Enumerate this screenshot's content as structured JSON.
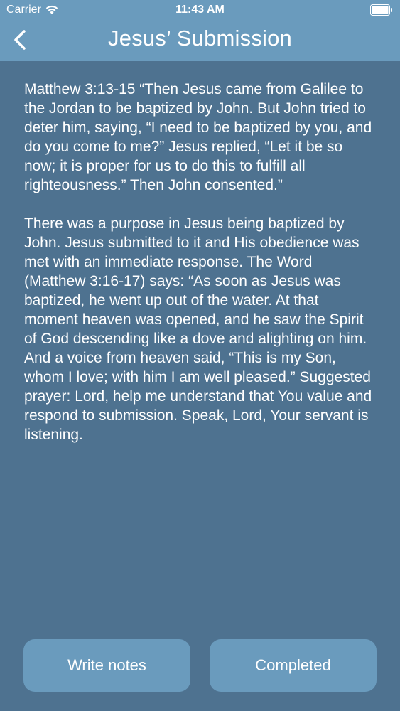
{
  "status_bar": {
    "carrier": "Carrier",
    "time": "11:43 AM"
  },
  "nav": {
    "title": "Jesus’ Submission",
    "back_icon": "chevron-left-icon"
  },
  "content": {
    "paragraphs": [
      "Matthew 3:13-15 “Then Jesus came from Galilee to the Jordan to be baptized by John. But John tried to deter him, saying, “I need to be baptized by you, and do you come to me?” Jesus replied, “Let it be so now; it is proper for us to do this to fulfill all righteousness.” Then John consented.”",
      "There was a purpose in Jesus being baptized by John. Jesus submitted to it and His obedience was met with an immediate response. The Word (Matthew 3:16-17) says: “As soon as Jesus was baptized, he went up out of the water. At that moment heaven was opened, and he saw the Spirit of God descending like a dove and alighting on him. And a voice from heaven said, “This is my Son, whom I love; with him I am well pleased.” Suggested prayer: Lord, help me understand that You value and respond to submission. Speak, Lord, Your servant is listening."
    ]
  },
  "actions": {
    "write_notes_label": "Write notes",
    "completed_label": "Completed"
  },
  "colors": {
    "background": "#4e7290",
    "bar": "#6a9bbd",
    "button": "#6a9bbd",
    "text": "#ffffff"
  }
}
